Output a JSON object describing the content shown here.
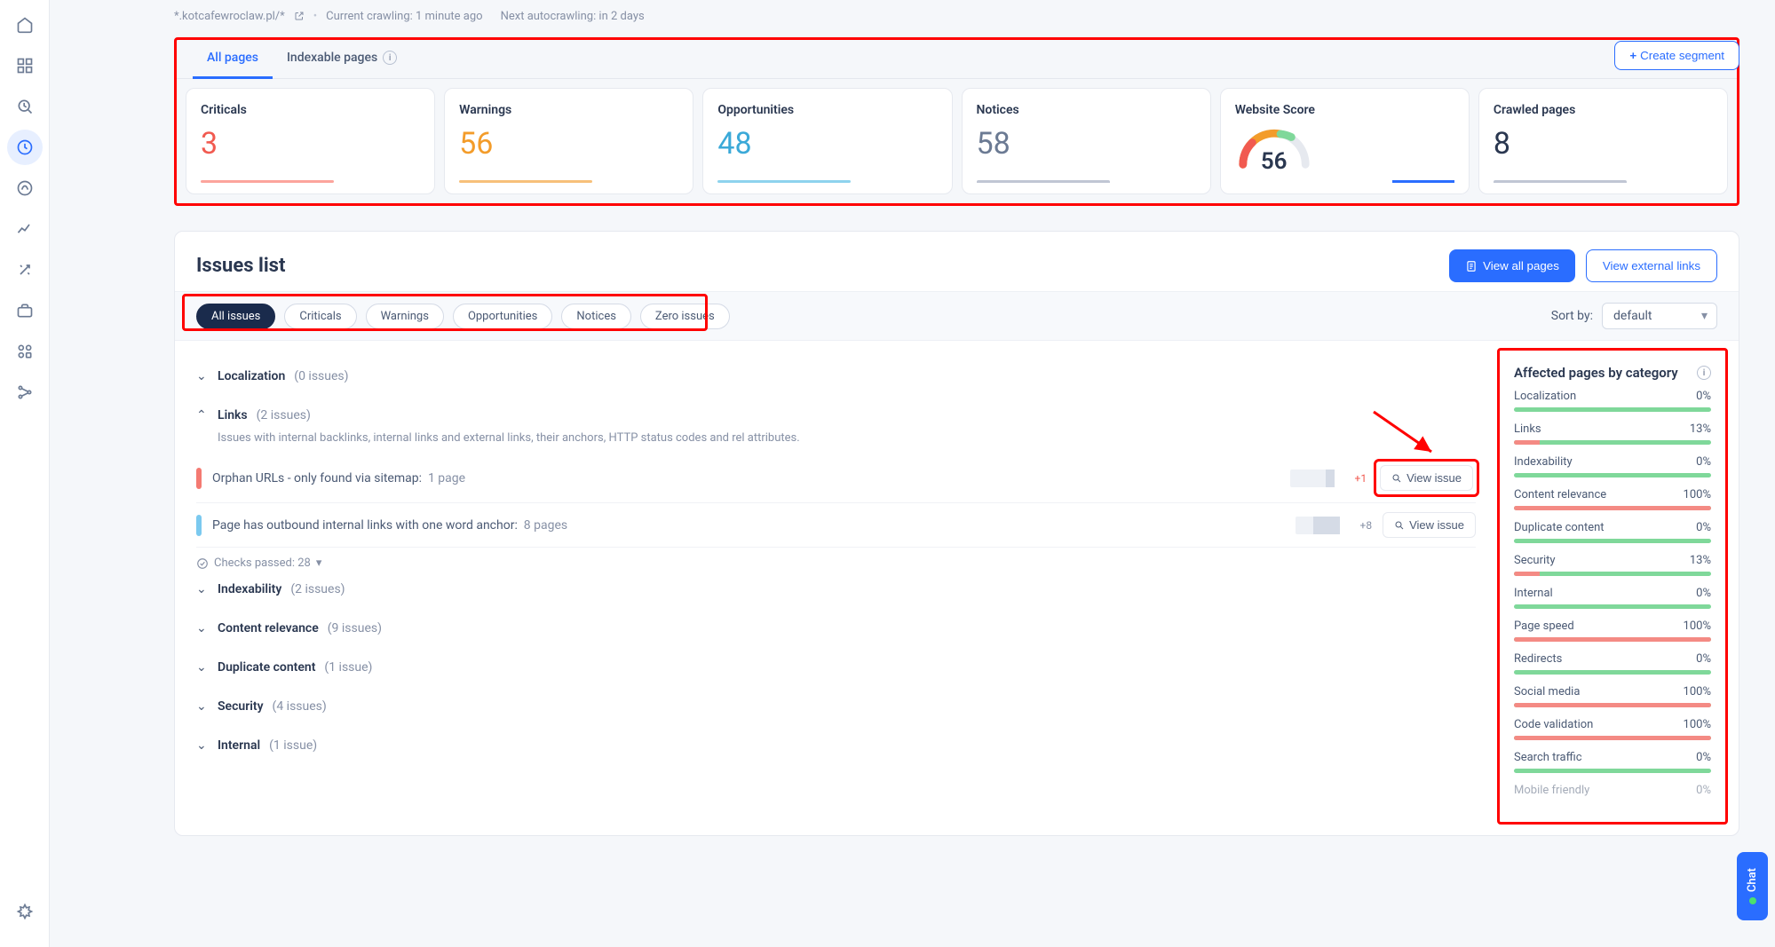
{
  "topbar": {
    "domain": "*.kotcafewroclaw.pl/*",
    "crawling": "Current crawling: 1 minute ago",
    "next": "Next autocrawling: in 2 days"
  },
  "tabs": {
    "all": "All pages",
    "indexable": "Indexable pages",
    "create_segment": "Create segment"
  },
  "stats": {
    "criticals_label": "Criticals",
    "criticals_value": "3",
    "warnings_label": "Warnings",
    "warnings_value": "56",
    "opportunities_label": "Opportunities",
    "opportunities_value": "48",
    "notices_label": "Notices",
    "notices_value": "58",
    "score_label": "Website Score",
    "score_value": "56",
    "crawled_label": "Crawled pages",
    "crawled_value": "8"
  },
  "issues": {
    "title": "Issues list",
    "view_all": "View all pages",
    "view_external": "View external links",
    "sort_label": "Sort by:",
    "sort_value": "default",
    "filters": {
      "all": "All issues",
      "criticals": "Criticals",
      "warnings": "Warnings",
      "opportunities": "Opportunities",
      "notices": "Notices",
      "zero": "Zero issues"
    },
    "cats": {
      "localization": {
        "name": "Localization",
        "count": "(0 issues)"
      },
      "links": {
        "name": "Links",
        "count": "(2 issues)",
        "desc": "Issues with internal backlinks, internal links and external links, their anchors, HTTP status codes and rel attributes.",
        "items": [
          {
            "text": "Orphan URLs - only found via sitemap:",
            "pages": "1 page",
            "delta": "+1",
            "view": "View issue"
          },
          {
            "text": "Page has outbound internal links with one word anchor:",
            "pages": "8 pages",
            "delta": "+8",
            "view": "View issue"
          }
        ],
        "passed": "Checks passed: 28"
      },
      "indexability": {
        "name": "Indexability",
        "count": "(2 issues)"
      },
      "content": {
        "name": "Content relevance",
        "count": "(9 issues)"
      },
      "duplicate": {
        "name": "Duplicate content",
        "count": "(1 issue)"
      },
      "security": {
        "name": "Security",
        "count": "(4 issues)"
      },
      "internal": {
        "name": "Internal",
        "count": "(1 issue)"
      }
    }
  },
  "affected": {
    "title": "Affected pages by category",
    "items": [
      {
        "name": "Localization",
        "pct": "0%",
        "val": 0
      },
      {
        "name": "Links",
        "pct": "13%",
        "val": 13
      },
      {
        "name": "Indexability",
        "pct": "0%",
        "val": 0
      },
      {
        "name": "Content relevance",
        "pct": "100%",
        "val": 100
      },
      {
        "name": "Duplicate content",
        "pct": "0%",
        "val": 0
      },
      {
        "name": "Security",
        "pct": "13%",
        "val": 13
      },
      {
        "name": "Internal",
        "pct": "0%",
        "val": 0
      },
      {
        "name": "Page speed",
        "pct": "100%",
        "val": 100
      },
      {
        "name": "Redirects",
        "pct": "0%",
        "val": 0
      },
      {
        "name": "Social media",
        "pct": "100%",
        "val": 100
      },
      {
        "name": "Code validation",
        "pct": "100%",
        "val": 100
      },
      {
        "name": "Search traffic",
        "pct": "0%",
        "val": 0
      },
      {
        "name": "Mobile friendly",
        "pct": "0%",
        "val": 0
      }
    ]
  },
  "chat": "Chat"
}
